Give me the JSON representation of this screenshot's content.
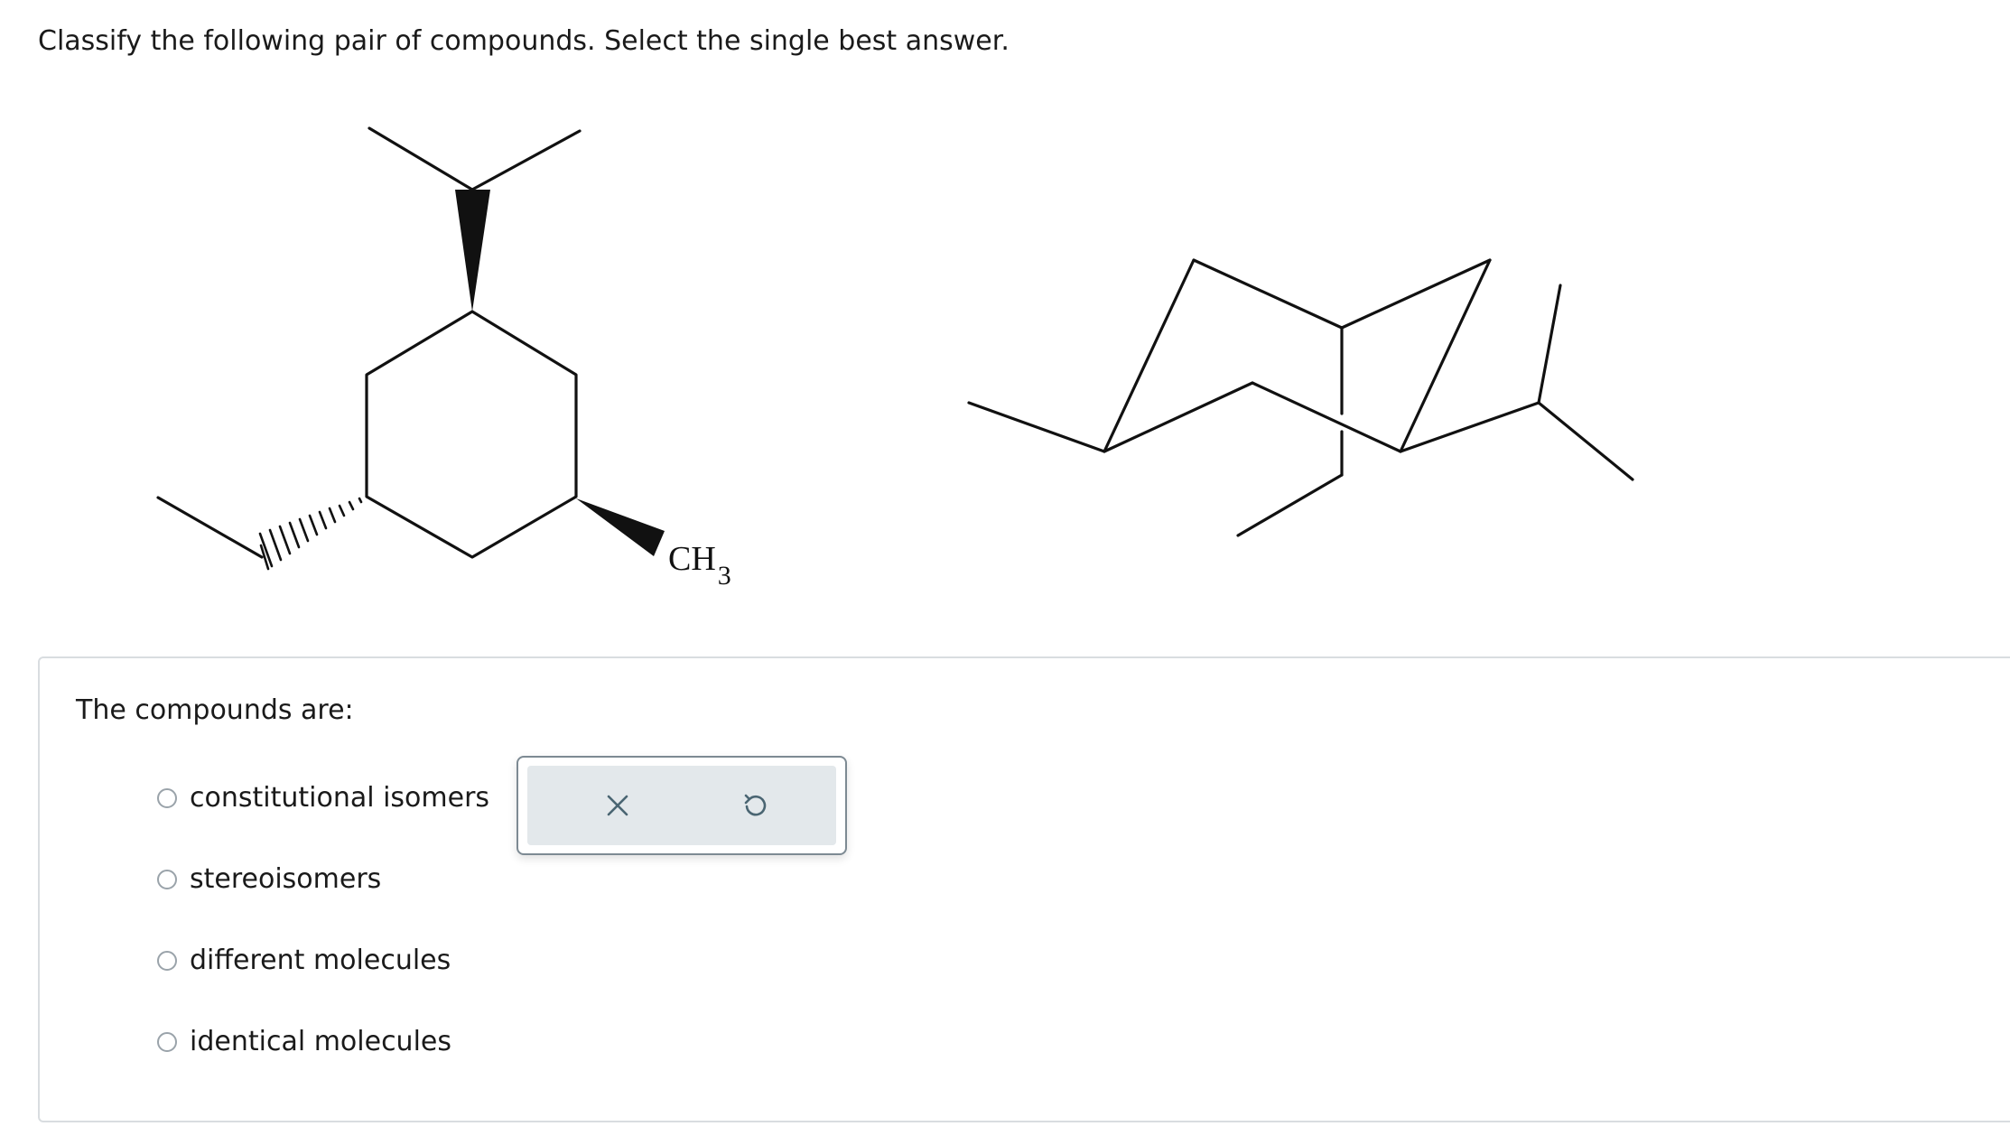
{
  "question": {
    "text": "Classify the following pair of compounds. Select the single best answer."
  },
  "structures": {
    "left_label_main": "CH",
    "left_label_sub": "3"
  },
  "answer": {
    "prompt": "The compounds are:",
    "options": [
      {
        "label": "constitutional isomers",
        "selected": false
      },
      {
        "label": "stereoisomers",
        "selected": false
      },
      {
        "label": "different molecules",
        "selected": false
      },
      {
        "label": "identical molecules",
        "selected": false
      }
    ],
    "tools": {
      "clear_icon": "close-icon",
      "reset_icon": "undo-icon",
      "panel_bg": "#e3e8eb",
      "icon_color": "#4a6572"
    }
  }
}
